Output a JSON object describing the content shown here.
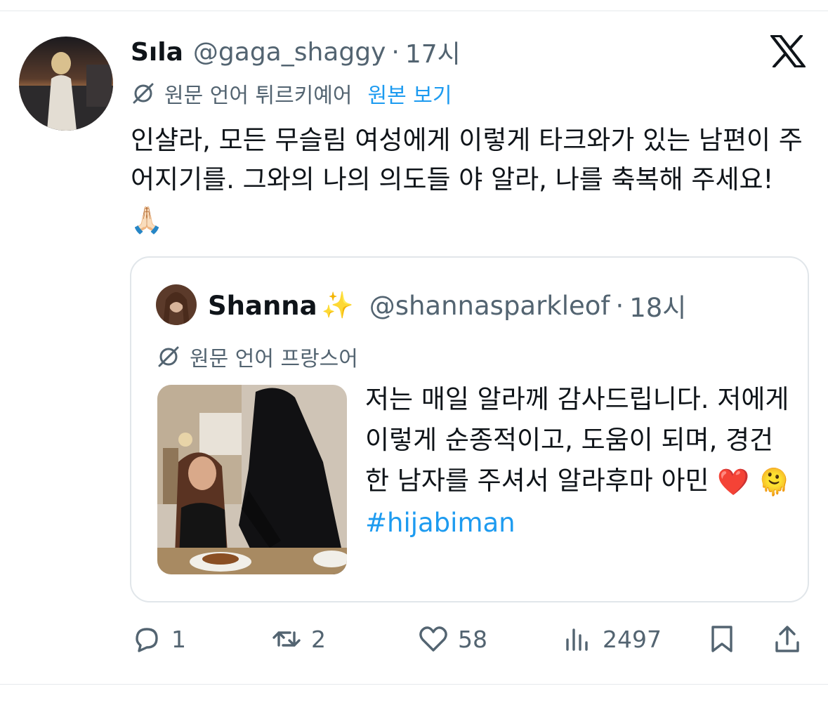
{
  "tweet": {
    "author_name": "Sıla",
    "author_handle": "@gaga_shaggy",
    "separator": "·",
    "time": "17시",
    "translation": {
      "icon": "translate-off-icon",
      "label": "원문 언어 튀르키예어",
      "show_original": "원본 보기"
    },
    "text": "인샬라, 모든 무슬림 여성에게 이렇게 타크와가 있는 남편이 주어지기를. 그와의 나의 의도들 야 알라, 나를 축복해 주세요!",
    "text_emoji": "🙏🏻"
  },
  "quote": {
    "author_name": "Shanna",
    "name_emoji": "✨",
    "author_handle": "@shannasparkleof",
    "separator": "·",
    "time": "18시",
    "translation": {
      "icon": "translate-off-icon",
      "label": "원문 언어 프랑스어"
    },
    "text": "저는 매일 알라께 감사드립니다. 저에게 이렇게 순종적이고, 도움이 되며, 경건한 남자를 주셔서 알라후마 아민",
    "emoji_heart": "❤️",
    "emoji_melt": "🫠",
    "hashtag": "#hijabiman"
  },
  "actions": {
    "reply_count": "1",
    "retweet_count": "2",
    "like_count": "58",
    "view_count": "2497"
  },
  "colors": {
    "text": "#0f1419",
    "muted": "#536471",
    "link": "#1d9bf0",
    "border": "#e1e6ea"
  },
  "icons": [
    "x-logo-icon",
    "translate-off-icon",
    "reply-icon",
    "retweet-icon",
    "like-icon",
    "views-icon",
    "bookmark-icon",
    "share-icon"
  ]
}
